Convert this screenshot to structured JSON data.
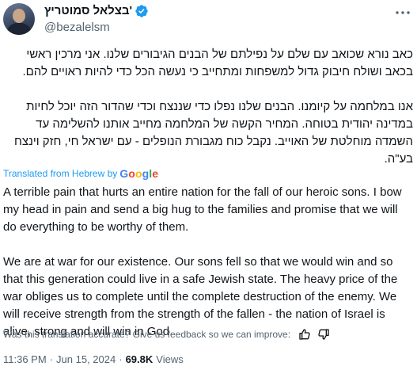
{
  "author": {
    "display_name": "בצלאל סמוטריץ'",
    "handle": "@bezalelsm"
  },
  "original_text": {
    "lang": "Hebrew",
    "paragraph_1": "כאב נורא שכואב עם שלם על נפילתם של הבנים הגיבורים שלנו. אני מרכין ראשי בכאב ושולח חיבוק גדול למשפחות ומתחייב כי נעשה הכל כדי להיות ראויים להם.",
    "paragraph_2": "אנו במלחמה על קיומנו. הבנים שלנו נפלו כדי שננצח וכדי שהדור הזה יוכל לחיות במדינה יהודית בטוחה. המחיר הקשה של המלחמה מחייב אותנו להשלימה עד השמדה מוחלטת של האוייב. נקבל כוח מגבורת הנופלים - עם ישראל חי, חזק וינצח בע\"ה."
  },
  "translation": {
    "label": "Translated from Hebrew by",
    "provider": "Google",
    "provider_colors": [
      "#4285f4",
      "#ea4335",
      "#fbbc05",
      "#4285f4",
      "#34a853",
      "#ea4335"
    ],
    "paragraph_1": "A terrible pain that hurts an entire nation for the fall of our heroic sons. I bow my head in pain and send a big hug to the families and promise that we will do everything to be worthy of them.",
    "paragraph_2": "We are at war for our existence. Our sons fell so that we would win and so that this generation could live in a safe Jewish state. The heavy price of the war obliges us to complete until the complete destruction of the enemy. We will receive strength from the strength of the fallen - the nation of Israel is alive, strong and will win in God.",
    "feedback_prompt": "Was this translation accurate? Give us feedback so we can improve:"
  },
  "meta": {
    "time": "11:36 PM",
    "date": "Jun 15, 2024",
    "separator": "·",
    "views_count": "69.8K",
    "views_label": "Views"
  },
  "icons": {
    "verified": "verified-badge-icon",
    "more": "more-horizontal-icon",
    "thumbs_up": "thumbs-up-icon",
    "thumbs_down": "thumbs-down-icon"
  },
  "colors": {
    "link_blue": "#1d9bf0",
    "secondary_text": "#536471",
    "primary_text": "#0f1419"
  }
}
